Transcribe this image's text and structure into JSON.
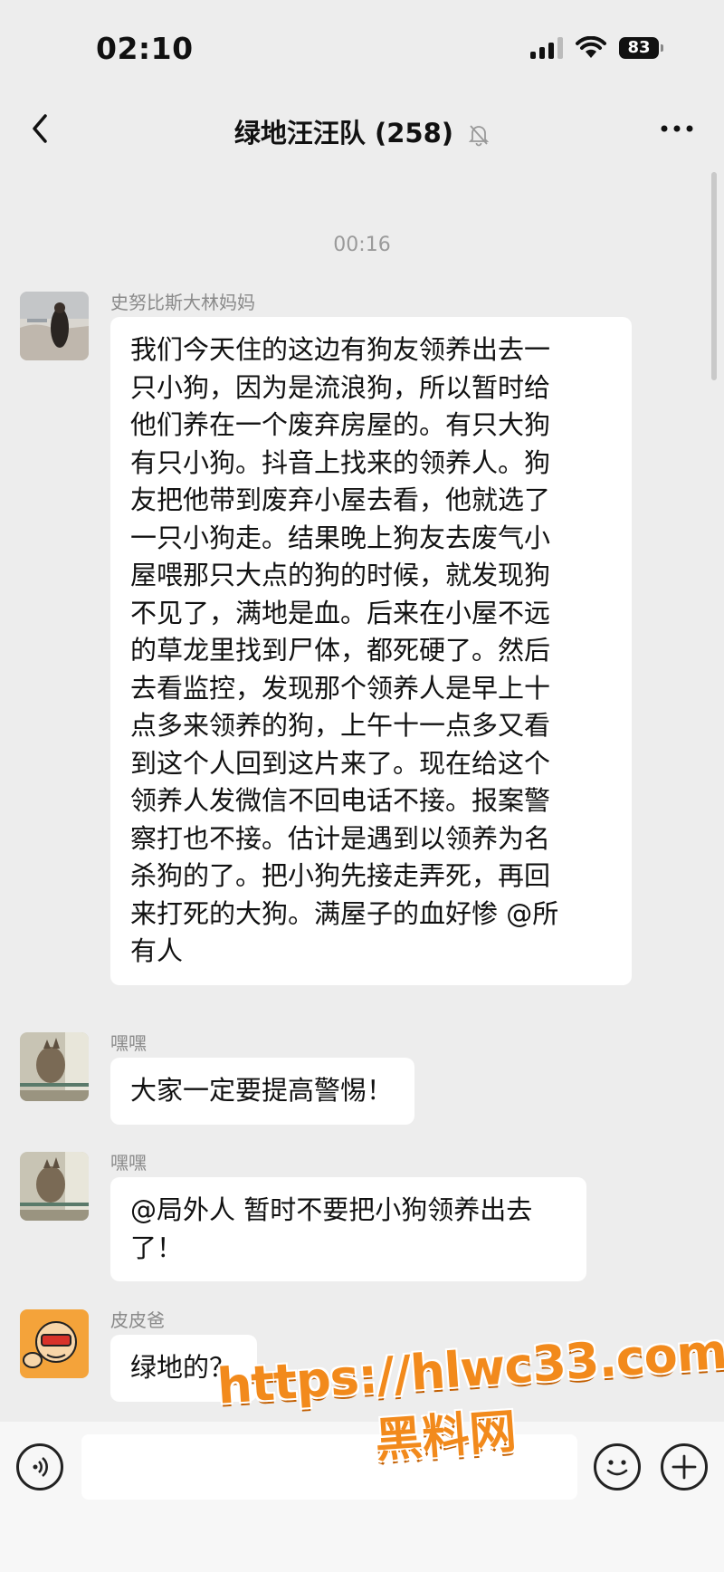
{
  "status_bar": {
    "time": "02:10",
    "battery": "83"
  },
  "header": {
    "title": "绿地汪汪队 (258)",
    "icons": [
      "back-arrow-icon",
      "bell-muted-icon",
      "more-icon"
    ]
  },
  "timestamp": "00:16",
  "messages": [
    {
      "sender": "史努比斯大林妈妈",
      "lines": [
        "我们今天住的这边有狗友领养出去一",
        "只小狗，因为是流浪狗，所以暂时给",
        "他们养在一个废弃房屋的。有只大狗",
        "有只小狗。抖音上找来的领养人。狗",
        "友把他带到废弃小屋去看，他就选了",
        "一只小狗走。结果晚上狗友去废气小",
        "屋喂那只大点的狗的时候，就发现狗",
        "不见了，满地是血。后来在小屋不远",
        "的草龙里找到尸体，都死硬了。然后",
        "去看监控，发现那个领养人是早上十",
        "点多来领养的狗，上午十一点多又看",
        "到这个人回到这片来了。现在给这个",
        "领养人发微信不回电话不接。报案警",
        "察打也不接。估计是遇到以领养为名",
        "杀狗的了。把小狗先接走弄死，再回",
        "来打死的大狗。满屋子的血好惨 @所",
        "有人"
      ]
    },
    {
      "sender": "嘿嘿",
      "lines": [
        "大家一定要提高警惕！"
      ]
    },
    {
      "sender": "嘿嘿",
      "lines": [
        "@局外人  暂时不要把小狗领养出去",
        "了！"
      ]
    },
    {
      "sender": "皮皮爸",
      "lines": [
        "绿地的？"
      ]
    }
  ],
  "input_bar": {
    "icons": [
      "voice-icon",
      "emoji-icon",
      "add-icon"
    ]
  },
  "watermark": {
    "url": "https://hlwc33.com",
    "name": "黑料网"
  },
  "colors": {
    "background": "#ededed",
    "bubble": "#ffffff",
    "watermark": "#f28a1c"
  }
}
